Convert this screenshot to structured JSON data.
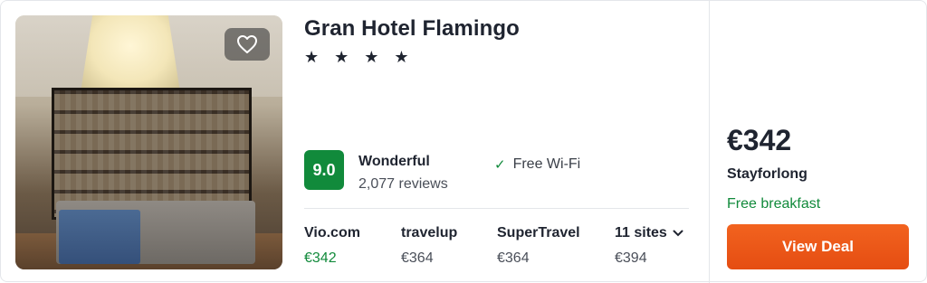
{
  "hotel": {
    "name": "Gran Hotel Flamingo",
    "stars": "★ ★ ★ ★",
    "favorite_icon": "heart-outline-icon"
  },
  "rating": {
    "score": "9.0",
    "label": "Wonderful",
    "reviews": "2,077 reviews",
    "color": "#118a3b"
  },
  "amenities": [
    {
      "icon": "check-icon",
      "label": "Free Wi-Fi"
    }
  ],
  "sites": [
    {
      "name": "Vio.com",
      "price": "€342"
    },
    {
      "name": "travelup",
      "price": "€364"
    },
    {
      "name": "SuperTravel",
      "price": "€364"
    }
  ],
  "more_sites": {
    "label": "11 sites",
    "price": "€394",
    "icon": "chevron-down-icon"
  },
  "deal": {
    "price": "€342",
    "site": "Stayforlong",
    "extra": "Free breakfast",
    "button": "View Deal",
    "accent": "#e85617"
  }
}
